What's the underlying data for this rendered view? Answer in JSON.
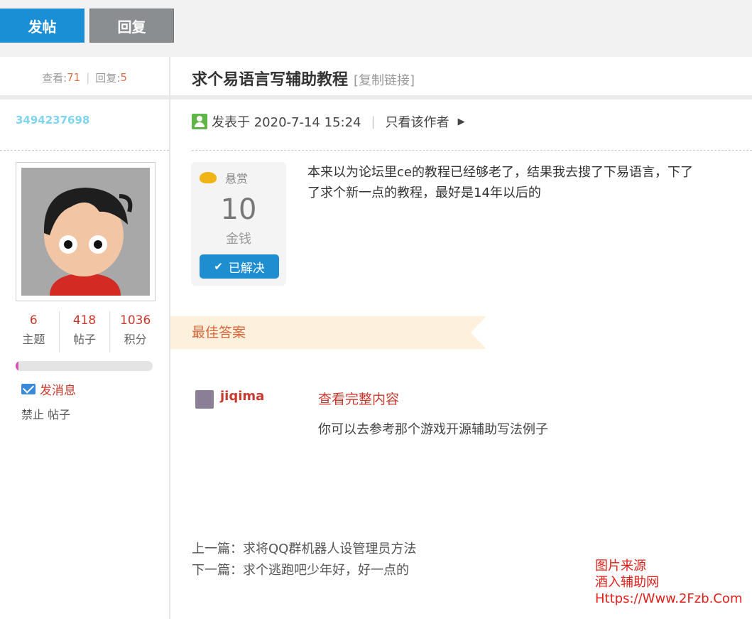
{
  "toolbar": {
    "post_label": "发帖",
    "reply_label": "回复"
  },
  "thread_stats": {
    "views_label": "查看:",
    "views": "71",
    "replies_label": "回复:",
    "replies": "5"
  },
  "thread": {
    "title": "求个易语言写辅助教程",
    "copy_link": "[复制链接]"
  },
  "author": {
    "username": "3494237698",
    "counts": [
      {
        "value": "6",
        "label": "主题"
      },
      {
        "value": "418",
        "label": "帖子"
      },
      {
        "value": "1036",
        "label": "积分"
      }
    ],
    "level_progress": 0.02,
    "send_message": "发消息",
    "ban_label": "禁止 帖子"
  },
  "post": {
    "posted_at": "发表于 2020-7-14 15:24",
    "only_author": "只看该作者",
    "content_line1": "本来以为论坛里ce的教程已经够老了，结果我去搜了下易语言，下了",
    "content_line2": "了求个新一点的教程，最好是14年以后的"
  },
  "bounty": {
    "label": "悬赏",
    "amount": "10",
    "unit": "金钱",
    "status": "已解决"
  },
  "best_answer": {
    "heading": "最佳答案",
    "username": "jiqima",
    "view_full": "查看完整内容",
    "text": "你可以去参考那个游戏开源辅助写法例子"
  },
  "navigation": {
    "prev": "上一篇：求将QQ群机器人设管理员方法",
    "next": "下一篇：求个逃跑吧少年好，好一点的"
  },
  "watermark": {
    "line1": "图片来源",
    "line2": "酒入辅助网",
    "line3": "Https://Www.2Fzb.Com"
  },
  "colors": {
    "accent_blue": "#1a8fd6",
    "red": "#c93a2e",
    "orange": "#d5734b"
  }
}
